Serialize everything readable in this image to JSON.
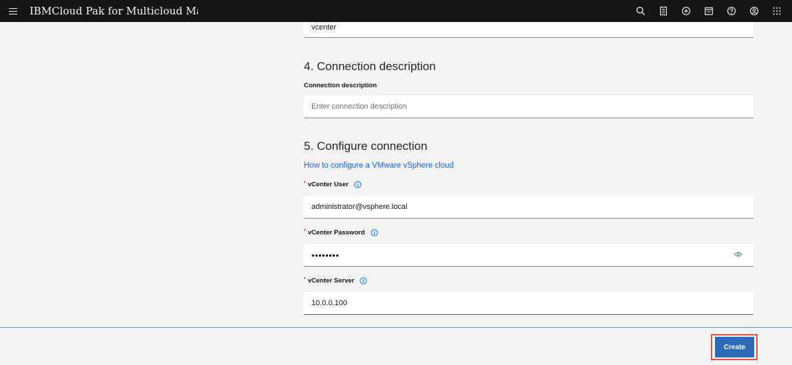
{
  "header": {
    "brand": "IBMCloud Pak for Multicloud Manager",
    "icons": [
      "search-icon",
      "documentation-icon",
      "add-icon",
      "calendar-icon",
      "help-icon",
      "user-icon",
      "app-switcher-icon"
    ]
  },
  "form": {
    "previous_field_value": "vcenter",
    "section4": {
      "title": "4. Connection description",
      "description_label": "Connection description",
      "description_placeholder": "Enter connection description"
    },
    "section5": {
      "title": "5. Configure connection",
      "help_link": "How to configure a VMware vSphere cloud",
      "user_label": "vCenter User",
      "user_value": "administrator@vsphere.local",
      "password_label": "vCenter Password",
      "password_value": "••••••••",
      "server_label": "vCenter Server",
      "server_value": "10.0.0.100",
      "required_marker": "*"
    }
  },
  "footer": {
    "create_label": "Create"
  },
  "colors": {
    "topbar": "#161616",
    "accent_link": "#0f62fe",
    "primary_button": "#2d6bb8",
    "highlight_outline": "#e8523f",
    "required": "#da1e28"
  }
}
